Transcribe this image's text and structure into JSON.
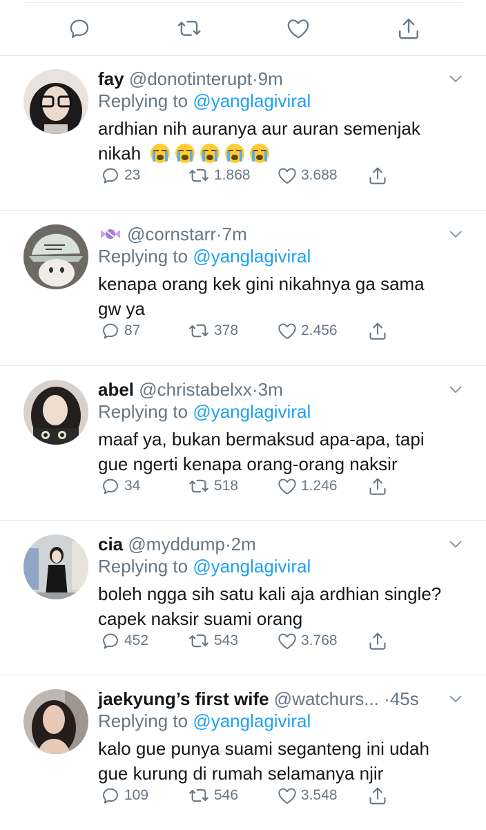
{
  "replying_label": "Replying to",
  "dot": "·",
  "top_actions": [
    "reply-icon",
    "retweet-icon",
    "like-icon",
    "share-icon"
  ],
  "colors": {
    "link": "#1da1f2",
    "muted": "#657786",
    "divider": "#e1e8ed"
  },
  "tweets": [
    {
      "name": "fay",
      "handle": "@donotinterupt",
      "time": "9m",
      "reply_to": "@yanglagiviral",
      "text_lines": [
        "ardhian nih auranya aur auran semenjak",
        "nikah"
      ],
      "emoji": "loudly-crying-face x5",
      "replies": "23",
      "retweets": "1.868",
      "likes": "3.688"
    },
    {
      "name": "",
      "handle": "@cornstarr",
      "time": "7m",
      "reply_to": "@yanglagiviral",
      "name_icon": "candy-icon",
      "text_lines": [
        "kenapa orang kek gini nikahnya ga sama",
        "gw ya"
      ],
      "replies": "87",
      "retweets": "378",
      "likes": "2.456"
    },
    {
      "name": "abel",
      "handle": "@christabelxx",
      "time": "3m",
      "reply_to": "@yanglagiviral",
      "text_lines": [
        "maaf ya, bukan bermaksud apa-apa, tapi",
        "gue ngerti kenapa orang-orang naksir"
      ],
      "replies": "34",
      "retweets": "518",
      "likes": "1.246"
    },
    {
      "name": "cia",
      "handle": "@myddump",
      "time": "2m",
      "reply_to": "@yanglagiviral",
      "text_lines": [
        "boleh ngga sih satu kali aja ardhian single?",
        "capek naksir suami orang"
      ],
      "replies": "452",
      "retweets": "543",
      "likes": "3.768"
    },
    {
      "name": "jaekyung’s first wife",
      "handle": "@watchurs...",
      "time": "45s",
      "reply_to": "@yanglagiviral",
      "text_lines": [
        "kalo gue punya suami seganteng ini udah",
        "gue kurung di rumah selamanya njir"
      ],
      "replies": "109",
      "retweets": "546",
      "likes": "3.548"
    }
  ]
}
